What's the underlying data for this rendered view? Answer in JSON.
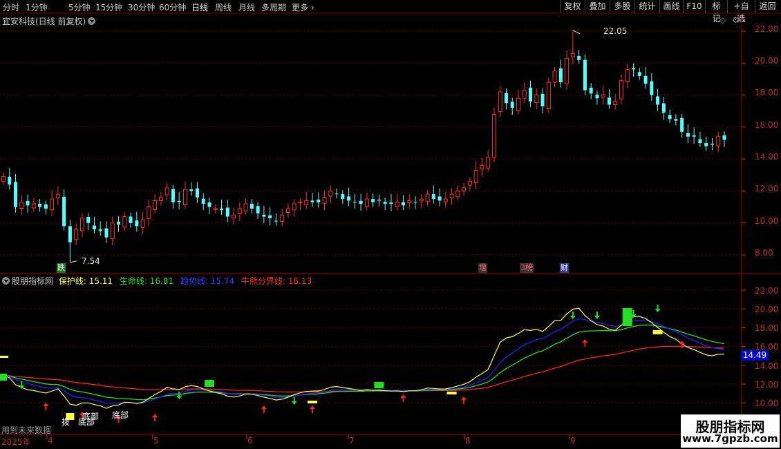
{
  "periods": [
    "分时",
    "1分钟",
    "5分钟",
    "15分钟",
    "30分钟",
    "60分钟",
    "日线",
    "周线",
    "月线",
    "多周期",
    "更多"
  ],
  "active_period": "日线",
  "toolbar": [
    "复权",
    "叠加",
    "多股",
    "统计",
    "画线",
    "F10",
    "+自选",
    "返回"
  ],
  "toolbar_extra": "标记",
  "upper": {
    "title": "宜安科技(日线 前复权)",
    "price_axis": [
      "22.00",
      "20.00",
      "18.00",
      "16.00",
      "14.00",
      "12.00",
      "10.00",
      "8.00"
    ],
    "high_label": "22.05",
    "low_label": "7.54",
    "tags": {
      "die": "跌",
      "zeng": "增",
      "bang": "榜",
      "cai": "财"
    }
  },
  "lower": {
    "name": "股朋指标网",
    "baohu": "保护线: 15.11",
    "shengming": "生命线: 16.81",
    "qushi": "趋势线: 15.74",
    "niuxiong": "牛熊分界线: 16.13",
    "axis": [
      "22.00",
      "20.00",
      "18.00",
      "16.00",
      "14.00",
      "12.00",
      "10.00"
    ],
    "current_price": "14.49",
    "labels": {
      "dibu1": "底部",
      "dibu2": "底部",
      "dibu3": "底部",
      "zhao": "拨"
    },
    "future_note": "用到未来数据"
  },
  "time_axis": {
    "year": "2025年",
    "months": [
      "4",
      "5",
      "6",
      "7",
      "8",
      "9"
    ]
  },
  "watermark": {
    "title": "股朋指标网",
    "url": "www.7gpzb.com"
  },
  "colors": {
    "up": "#ff3030",
    "down": "#54ffff",
    "axis": "#c03030",
    "baohu": "#ffff44",
    "shengming": "#22dd22",
    "qushi": "#2222ff",
    "niuxiong": "#ff2222"
  },
  "chart_data": {
    "type": "candlestick",
    "ylim": [
      7,
      23
    ],
    "high": 22.05,
    "low": 7.54,
    "close": [
      12.9,
      12.4,
      11.0,
      11.3,
      11.1,
      11.2,
      11.0,
      10.9,
      11.5,
      11.8,
      9.8,
      8.8,
      9.6,
      10.3,
      10.0,
      9.6,
      9.5,
      9.1,
      10.0,
      9.9,
      10.4,
      10.0,
      9.8,
      10.2,
      11.0,
      11.4,
      11.6,
      12.2,
      11.3,
      11.3,
      12.1,
      12.0,
      11.6,
      11.2,
      11.0,
      10.9,
      10.8,
      10.4,
      10.5,
      10.9,
      11.2,
      10.9,
      10.6,
      10.4,
      10.3,
      10.1,
      10.5,
      10.9,
      11.2,
      11.3,
      11.4,
      11.3,
      11.3,
      11.6,
      12.0,
      11.8,
      11.5,
      11.4,
      11.3,
      11.2,
      11.5,
      11.3,
      11.4,
      11.2,
      11.2,
      11.3,
      11.1,
      11.4,
      11.3,
      11.5,
      11.8,
      11.5,
      11.4,
      11.5,
      11.8,
      12.0,
      12.2,
      12.6,
      13.3,
      13.6,
      14.1,
      16.8,
      18.2,
      17.5,
      17.2,
      17.8,
      18.3,
      17.6,
      18.0,
      17.3,
      18.8,
      19.5,
      18.8,
      20.3,
      20.6,
      20.2,
      18.3,
      18.1,
      17.8,
      18.0,
      17.4,
      17.6,
      18.9,
      19.6,
      19.6,
      19.2,
      18.7,
      18.0,
      17.4,
      16.9,
      16.5,
      16.4,
      15.7,
      15.4,
      15.4,
      15.0,
      14.8,
      14.9,
      15.4,
      15.2
    ]
  }
}
